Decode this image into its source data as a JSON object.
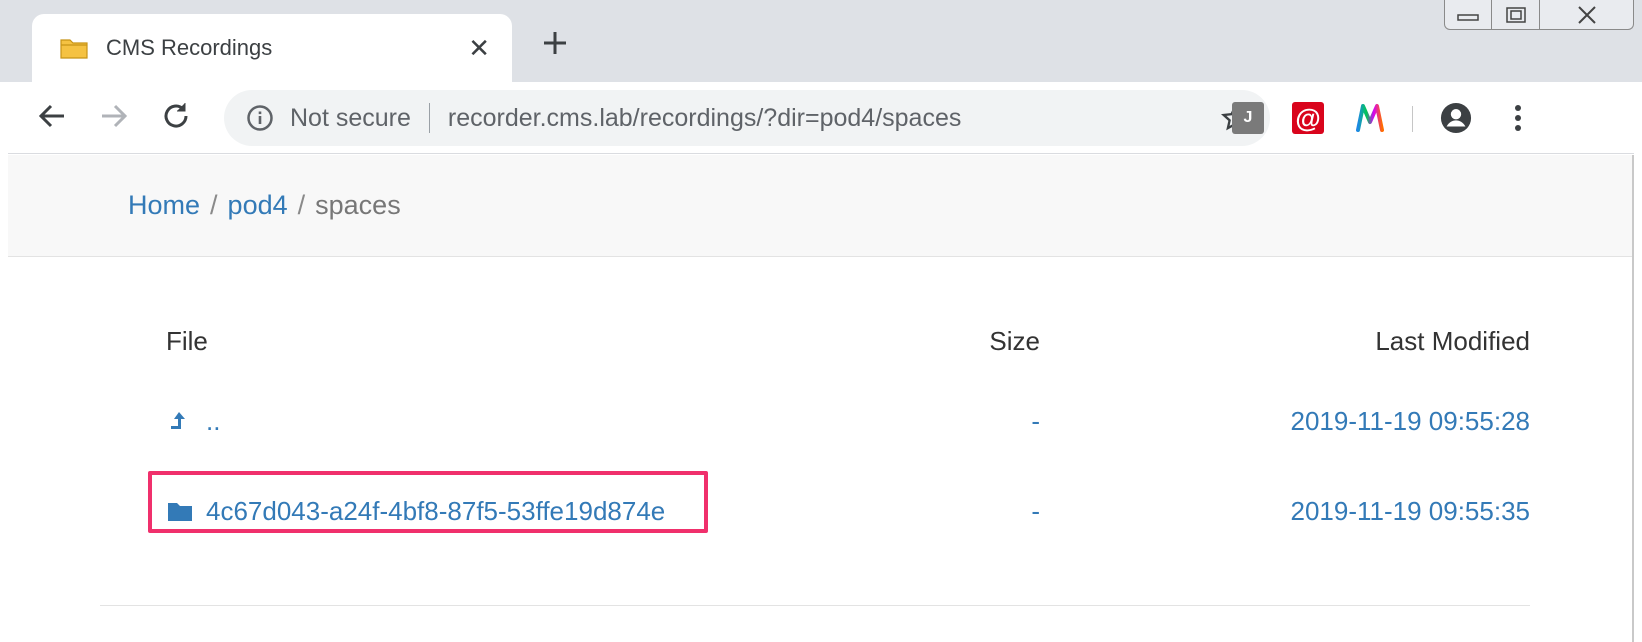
{
  "browser": {
    "tab_title": "CMS Recordings",
    "omnibox": {
      "security_label": "Not secure",
      "url": "recorder.cms.lab/recordings/?dir=pod4/spaces"
    },
    "extensions": [
      {
        "name": "j-extension-icon",
        "label": "J"
      },
      {
        "name": "at-extension-icon",
        "label": "@"
      },
      {
        "name": "m-extension-icon",
        "label": "M"
      }
    ]
  },
  "breadcrumb": {
    "items": [
      {
        "label": "Home"
      },
      {
        "label": "pod4"
      }
    ],
    "separator": "/",
    "current": "spaces"
  },
  "table": {
    "headers": {
      "file": "File",
      "size": "Size",
      "modified": "Last Modified"
    },
    "rows": [
      {
        "icon": "level-up-icon",
        "name": "..",
        "size": "-",
        "modified": "2019-11-19 09:55:28"
      },
      {
        "icon": "folder-icon",
        "name": "4c67d043-a24f-4bf8-87f5-53ffe19d874e",
        "size": "-",
        "modified": "2019-11-19 09:55:35",
        "highlighted": true
      }
    ]
  },
  "colors": {
    "link": "#337ab7",
    "highlight": "#f0306c",
    "at_extension": "#d9041c"
  }
}
